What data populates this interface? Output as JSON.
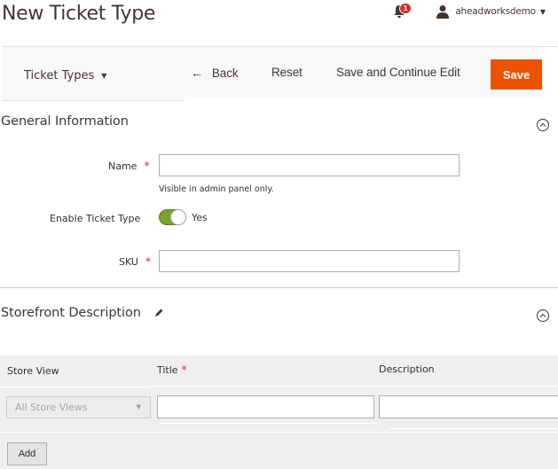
{
  "header": {
    "title": "New Ticket Type",
    "notifications": {
      "icon": "bell-icon",
      "count": "1"
    },
    "user": {
      "icon": "user-icon",
      "name": "aheadworksdemo",
      "caret": "▼"
    }
  },
  "actions": {
    "switcher": {
      "label": "Ticket Types",
      "caret": "▼"
    },
    "back_arrow": "←",
    "back_label": "Back",
    "reset_label": "Reset",
    "save_continue_label": "Save and Continue Edit",
    "save_label": "Save"
  },
  "general": {
    "title": "General Information",
    "name": {
      "label": "Name",
      "required": "*",
      "value": "",
      "note": "Visible in admin panel only."
    },
    "enable": {
      "label": "Enable Ticket Type",
      "value_label": "Yes",
      "checked": true
    },
    "sku": {
      "label": "SKU",
      "required": "*",
      "value": ""
    }
  },
  "storefront": {
    "title": "Storefront Description",
    "columns": [
      {
        "label": "Store View",
        "required": ""
      },
      {
        "label": "Title",
        "required": "*"
      },
      {
        "label": "Description",
        "required": ""
      }
    ],
    "rows": [
      {
        "store_view": "All Store Views",
        "title": "",
        "description": ""
      }
    ],
    "add_label": "Add"
  },
  "colors": {
    "accent": "#eb5202",
    "toggle_on": "#79a22e",
    "required": "#e22626",
    "badge": "#e22626"
  }
}
